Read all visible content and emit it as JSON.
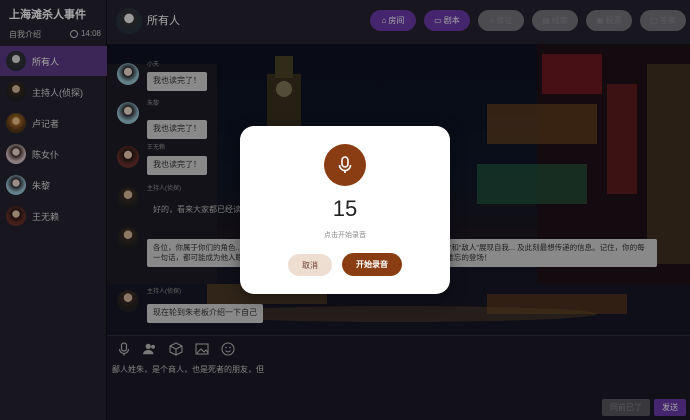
{
  "sidebar": {
    "title": "上海滩杀人事件",
    "intro_label": "自我介绍",
    "time": "14:08",
    "items": [
      {
        "label": "所有人",
        "active": true
      },
      {
        "label": "主持人(侦探)",
        "active": false
      },
      {
        "label": "卢记者",
        "active": false
      },
      {
        "label": "陈女仆",
        "active": false
      },
      {
        "label": "朱黎",
        "active": false
      },
      {
        "label": "王无赖",
        "active": false
      }
    ]
  },
  "header": {
    "title": "所有人",
    "buttons": [
      {
        "label": "房间",
        "enabled": true
      },
      {
        "label": "剧本",
        "enabled": true
      },
      {
        "label": "搜证",
        "enabled": false
      },
      {
        "label": "线索",
        "enabled": false
      },
      {
        "label": "投票",
        "enabled": false
      },
      {
        "label": "答案",
        "enabled": false
      }
    ]
  },
  "chat": {
    "messages": [
      {
        "name": "小天",
        "text": "我也读完了！"
      },
      {
        "name": "朱黎",
        "text": "我也读完了！"
      },
      {
        "name": "王无赖",
        "text": "我也读完了！"
      },
      {
        "name": "主持人(侦探)",
        "text": "好的，看来大家都已经读完了。"
      },
      {
        "name": "",
        "text": "各位，你属于你们的角色... 人的秘密，或背负着沉重的过往。现在，是时候向在场的“同伴”和“敌人”展现自我... 及此刻最想传递的信息。记住，你的每一句话，都可能成为他人眼中的线索，或是迷惑众人... 当浦江夜色的舞台上，留下最令人难忘的登场！"
      },
      {
        "name": "主持人(侦探)",
        "text": "现在轮到朱老板介绍一下自己"
      }
    ]
  },
  "input": {
    "text": "鄙人姓朱，是个商人，也是死者的朋友，但",
    "save_label": "同前已了",
    "send_label": "发送"
  },
  "modal": {
    "countdown": "15",
    "hint": "点击开始录音",
    "cancel_label": "取消",
    "start_label": "开始录音"
  },
  "colors": {
    "accent": "#6b3aa8",
    "record": "#8a3d12"
  }
}
